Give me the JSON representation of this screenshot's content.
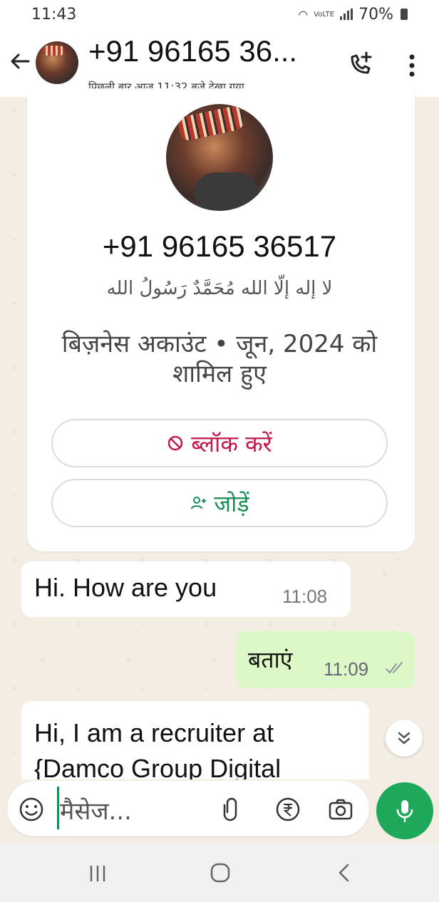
{
  "status_bar": {
    "time": "11:43",
    "battery": "70%",
    "network": "VoLTE"
  },
  "header": {
    "title": "+91 96165 36...",
    "subtitle": "पिछली बार आज 11:32 बजे देखा गया",
    "icons": [
      "back-arrow-icon",
      "add-call-icon",
      "more-vert-icon"
    ]
  },
  "contact_card": {
    "number": "+91 96165 36517",
    "about": "لا إله إلّا الله مُحَمَّدٌ رَسُولُ الله",
    "business_info": "बिज़नेस अकाउंट • जून, 2024 को शामिल हुए",
    "block_label": "ब्लॉक करें",
    "add_label": "जोड़ें"
  },
  "messages": [
    {
      "direction": "incoming",
      "text": "Hi. How are you",
      "time": "11:08"
    },
    {
      "direction": "outgoing",
      "text": "बताएं",
      "time": "11:09"
    },
    {
      "direction": "incoming",
      "text": "Hi, I am a recruiter at {Damco Group Digital"
    }
  ],
  "input": {
    "placeholder": "मैसेज..."
  },
  "colors": {
    "accent_green": "#1da85a",
    "outgoing_bubble": "#dcf8c6",
    "block_red": "#c2184b",
    "chat_background": "#f3ede3"
  }
}
